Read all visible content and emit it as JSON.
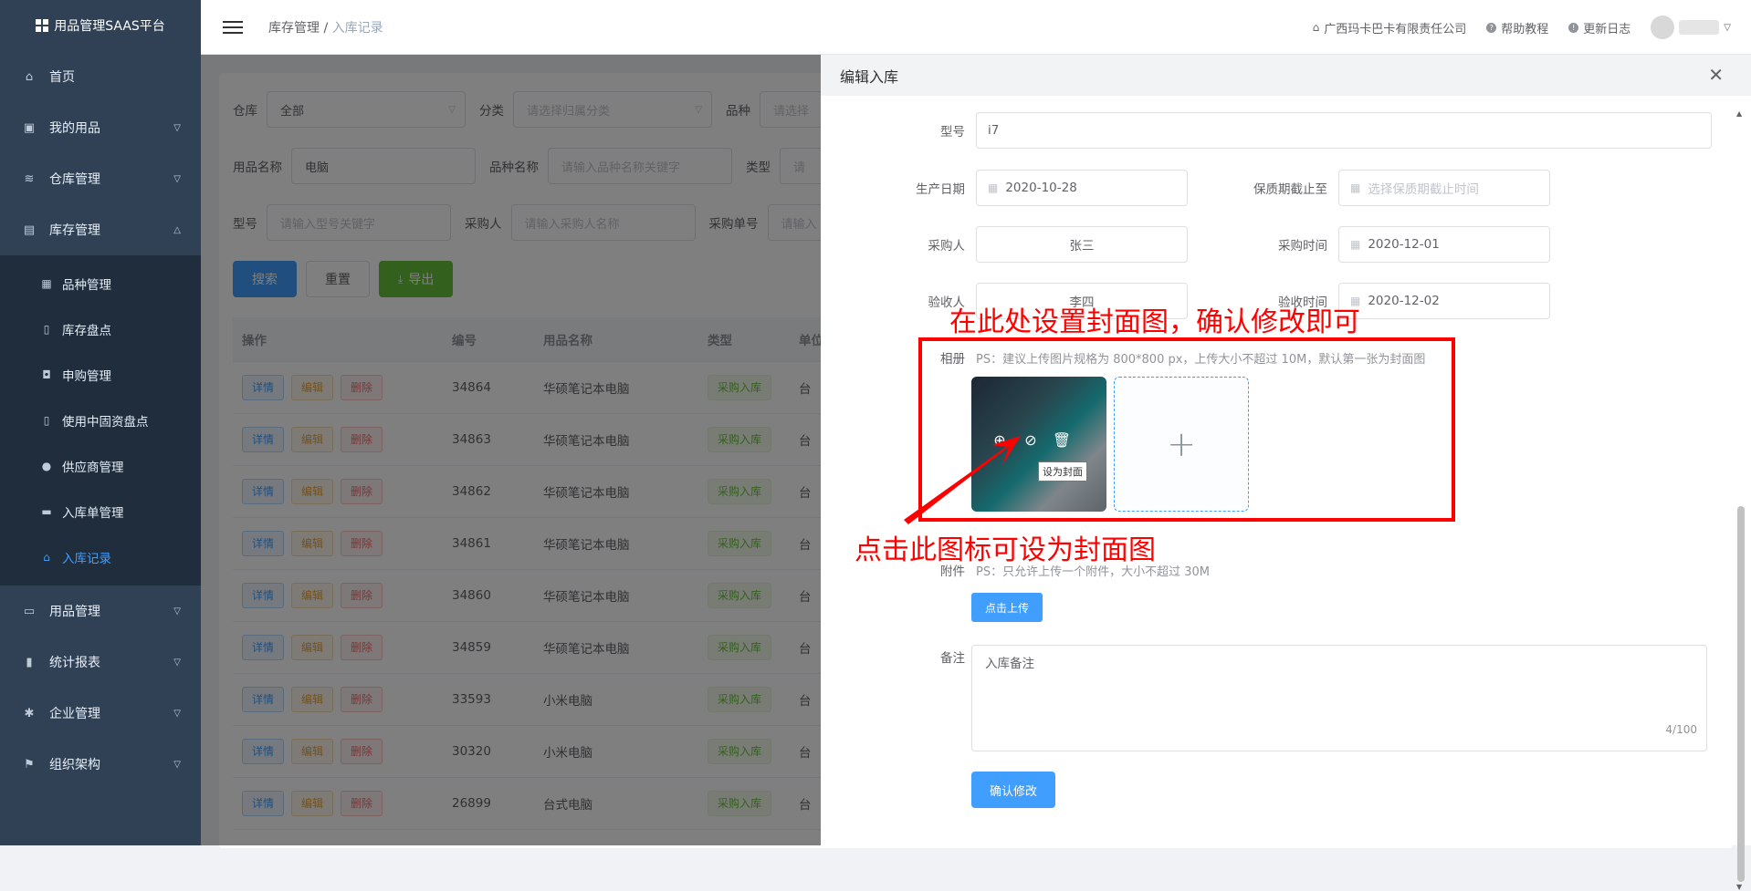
{
  "app": {
    "title": "用品管理SAAS平台"
  },
  "sidebar": {
    "items": [
      {
        "label": "首页",
        "icon": "home-icon"
      },
      {
        "label": "我的用品",
        "icon": "bag-icon"
      },
      {
        "label": "仓库管理",
        "icon": "database-icon"
      },
      {
        "label": "库存管理",
        "icon": "box-icon"
      }
    ],
    "sub_items": [
      {
        "label": "品种管理",
        "icon": "grid-icon"
      },
      {
        "label": "库存盘点",
        "icon": "document-icon"
      },
      {
        "label": "申购管理",
        "icon": "shopping-bag-icon"
      },
      {
        "label": "使用中固资盘点",
        "icon": "document-icon"
      },
      {
        "label": "供应商管理",
        "icon": "user-icon"
      },
      {
        "label": "入库单管理",
        "icon": "printer-icon"
      },
      {
        "label": "入库记录",
        "icon": "home-icon"
      }
    ],
    "bottom_items": [
      {
        "label": "用品管理",
        "icon": "tray-icon"
      },
      {
        "label": "统计报表",
        "icon": "bar-chart-icon"
      },
      {
        "label": "企业管理",
        "icon": "gear-icon"
      },
      {
        "label": "组织架构",
        "icon": "flag-icon"
      }
    ]
  },
  "header": {
    "breadcrumb_parent": "库存管理",
    "breadcrumb_sep": "/",
    "breadcrumb_current": "入库记录",
    "company": "广西玛卡巴卡有限责任公司",
    "help": "帮助教程",
    "changelog": "更新日志"
  },
  "filters": {
    "warehouse_label": "仓库",
    "warehouse_value": "全部",
    "category_label": "分类",
    "category_placeholder": "请选择归属分类",
    "variety_label": "品种",
    "variety_placeholder": "请选择",
    "name_label": "用品名称",
    "name_value": "电脑",
    "variety_name_label": "品种名称",
    "variety_name_placeholder": "请输入品种名称关键字",
    "type_label": "类型",
    "type_placeholder": "请",
    "model_label": "型号",
    "model_placeholder": "请输入型号关键字",
    "buyer_label": "采购人",
    "buyer_placeholder": "请输入采购人名称",
    "order_label": "采购单号",
    "order_placeholder": "请输入"
  },
  "actions": {
    "search": "搜索",
    "reset": "重置",
    "export": "导出"
  },
  "table": {
    "columns": [
      "操作",
      "编号",
      "用品名称",
      "类型",
      "单位"
    ],
    "row_buttons": {
      "detail": "详情",
      "edit": "编辑",
      "delete": "删除"
    },
    "rows": [
      {
        "id": "34864",
        "name": "华硕笔记本电脑",
        "type": "采购入库",
        "unit": "台"
      },
      {
        "id": "34863",
        "name": "华硕笔记本电脑",
        "type": "采购入库",
        "unit": "台"
      },
      {
        "id": "34862",
        "name": "华硕笔记本电脑",
        "type": "采购入库",
        "unit": "台"
      },
      {
        "id": "34861",
        "name": "华硕笔记本电脑",
        "type": "采购入库",
        "unit": "台"
      },
      {
        "id": "34860",
        "name": "华硕笔记本电脑",
        "type": "采购入库",
        "unit": "台"
      },
      {
        "id": "34859",
        "name": "华硕笔记本电脑",
        "type": "采购入库",
        "unit": "台"
      },
      {
        "id": "33593",
        "name": "小米电脑",
        "type": "采购入库",
        "unit": "台"
      },
      {
        "id": "30320",
        "name": "小米电脑",
        "type": "采购入库",
        "unit": "台"
      },
      {
        "id": "26899",
        "name": "台式电脑",
        "type": "采购入库",
        "unit": "台"
      }
    ]
  },
  "drawer": {
    "title": "编辑入库",
    "model_label": "型号",
    "model_value": "i7",
    "mfg_label": "生产日期",
    "mfg_value": "2020-10-28",
    "expiry_label": "保质期截止至",
    "expiry_placeholder": "选择保质期截止时间",
    "buyer_label": "采购人",
    "buyer_value": "张三",
    "buy_time_label": "采购时间",
    "buy_time_value": "2020-12-01",
    "inspector_label": "验收人",
    "inspector_value": "李四",
    "inspect_time_label": "验收时间",
    "inspect_time_value": "2020-12-02",
    "album_label": "相册",
    "album_hint": "PS：建议上传图片规格为 800*800 px，上传大小不超过 10M，默认第一张为封面图",
    "cover_tooltip": "设为封面",
    "attach_label": "附件",
    "attach_hint": "PS：只允许上传一个附件，大小不超过 30M",
    "upload_button": "点击上传",
    "note_label": "备注",
    "note_value": "入库备注",
    "note_counter": "4/100",
    "confirm_button": "确认修改"
  },
  "annotations": {
    "top_text": "在此处设置封面图，确认修改即可",
    "bottom_text": "点击此图标可设为封面图",
    "color": "#ff0000"
  },
  "colors": {
    "sidebar": "#304156",
    "primary": "#409eff",
    "success": "#67c23a",
    "warning": "#e6a23c",
    "danger": "#f56c6c"
  }
}
